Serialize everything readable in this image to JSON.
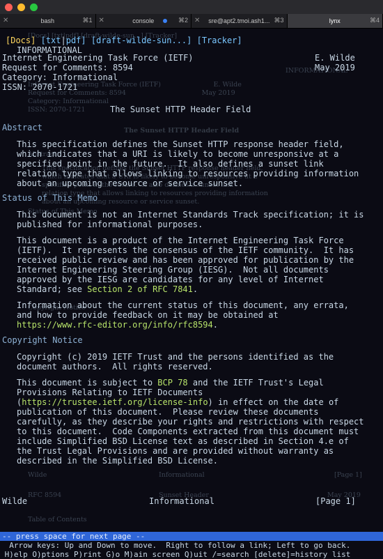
{
  "window": {
    "title": ""
  },
  "tabs": [
    {
      "label": "bash",
      "shortcut": "⌘1",
      "active": false
    },
    {
      "label": "console",
      "shortcut": "⌘2",
      "active": false
    },
    {
      "label": "sre@apt2.tmoi.ash1...",
      "shortcut": "⌘3",
      "active": false
    },
    {
      "label": "lynx",
      "shortcut": "⌘4",
      "active": true
    }
  ],
  "page": {
    "nav": {
      "docs": "[Docs]",
      "txt": "[txt",
      "pdf": "pdf]",
      "draft": "[draft-wilde-sun...]",
      "tracker": "[Tracker]"
    },
    "status_label": "INFORMATIONAL",
    "header": [
      {
        "left": "Internet Engineering Task Force (IETF)",
        "right": "E. Wilde"
      },
      {
        "left": "Request for Comments: 8594",
        "right": "May 2019"
      },
      {
        "left": "Category: Informational",
        "right": ""
      },
      {
        "left": "ISSN: 2070-1721",
        "right": ""
      }
    ],
    "title": "The Sunset HTTP Header Field",
    "sections": {
      "abstract": {
        "heading": "Abstract",
        "lines": [
          "This specification defines the Sunset HTTP response header field,",
          "which indicates that a URI is likely to become unresponsive at a",
          "specified point in the future.  It also defines a sunset link",
          "relation type that allows linking to resources providing information",
          "about an upcoming resource or service sunset."
        ]
      },
      "status": {
        "heading": "Status of This Memo",
        "p1": [
          "This document is not an Internet Standards Track specification; it is",
          "published for informational purposes."
        ],
        "p2": [
          "This document is a product of the Internet Engineering Task Force",
          "(IETF).  It represents the consensus of the IETF community.  It has",
          "received public review and has been approved for publication by the",
          "Internet Engineering Steering Group (IESG).  Not all documents",
          "approved by the IESG are candidates for any level of Internet"
        ],
        "p2_last_prefix": "Standard; see ",
        "p2_link": "Section 2 of RFC 7841",
        "p2_last_suffix": ".",
        "p3": [
          "Information about the current status of this document, any errata,",
          "and how to provide feedback on it may be obtained at"
        ],
        "p3_link": "https://www.rfc-editor.org/info/rfc8594",
        "p3_suffix": "."
      },
      "copyright": {
        "heading": "Copyright Notice",
        "p1": [
          "Copyright (c) 2019 IETF Trust and the persons identified as the",
          "document authors.  All rights reserved."
        ],
        "p2_l1_prefix": "This document is subject to ",
        "p2_l1_link": "BCP 78",
        "p2_l1_suffix": " and the IETF Trust's Legal",
        "p2_l2": "Provisions Relating to IETF Documents",
        "p2_l3_open": "(",
        "p2_l3_link": "https://trustee.ietf.org/license-info",
        "p2_l3_suffix": ") in effect on the date of",
        "p2_rest": [
          "publication of this document.  Please review these documents",
          "carefully, as they describe your rights and restrictions with respect",
          "to this document.  Code Components extracted from this document must",
          "include Simplified BSD License text as described in Section 4.e of",
          "the Trust Legal Provisions and are provided without warranty as",
          "described in the Simplified BSD License."
        ]
      }
    },
    "footer": {
      "left": "Wilde",
      "center": "Informational",
      "right": "[Page 1]"
    }
  },
  "ghost": {
    "nav": "[Docs] [txt|pdf] [draft-wilde-sun...] [Tracker]",
    "info": "INFORMATIONAL",
    "lines": [
      "Internet Engineering Task Force (IETF)                         E. Wilde",
      "Request for Comments: 8594                                    May 2019",
      "Category: Informational",
      "ISSN: 2070-1721"
    ],
    "title": "The Sunset HTTP Header Field",
    "abstract": "Abstract",
    "abs_lines": [
      "This specification defines the Sunset HTTP response header field,",
      "which indicates that a URI is likely to become unresponsive at a",
      "specified point in the future.  It also defines a sunset link",
      "relation type that allows linking to resources providing information",
      "about an upcoming resource or service sunset."
    ],
    "status": "Status of This Memo",
    "copyright": "Copyright Notice",
    "footer_left": "Wilde",
    "footer_center": "Informational",
    "footer_right": "[Page 1]",
    "rfc": "RFC 8594",
    "sunset": "Sunset Header",
    "may": "May 2019",
    "toc": "Table of Contents"
  },
  "statusbar": {
    "prompt": "-- press space for next page --"
  },
  "help": {
    "line1": "  Arrow keys: Up and Down to move.  Right to follow a link; Left to go back.",
    "line2": " H)elp O)ptions P)rint G)o M)ain screen Q)uit /=search [delete]=history list"
  }
}
